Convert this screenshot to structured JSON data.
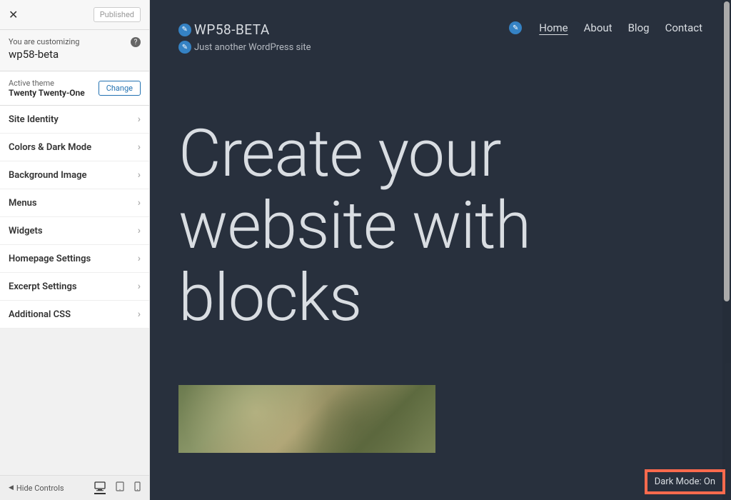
{
  "panel": {
    "published_label": "Published",
    "customizing_text": "You are customizing",
    "site_name": "wp58-beta",
    "theme_label": "Active theme",
    "theme_name": "Twenty Twenty-One",
    "change_label": "Change",
    "sections": [
      "Site Identity",
      "Colors & Dark Mode",
      "Background Image",
      "Menus",
      "Widgets",
      "Homepage Settings",
      "Excerpt Settings",
      "Additional CSS"
    ],
    "hide_controls_label": "Hide Controls"
  },
  "preview": {
    "site_title": "WP58-BETA",
    "site_tagline": "Just another WordPress site",
    "nav": [
      "Home",
      "About",
      "Blog",
      "Contact"
    ],
    "nav_active": 0,
    "hero_title": "Create your website with blocks",
    "dark_mode_label": "Dark Mode: On"
  }
}
